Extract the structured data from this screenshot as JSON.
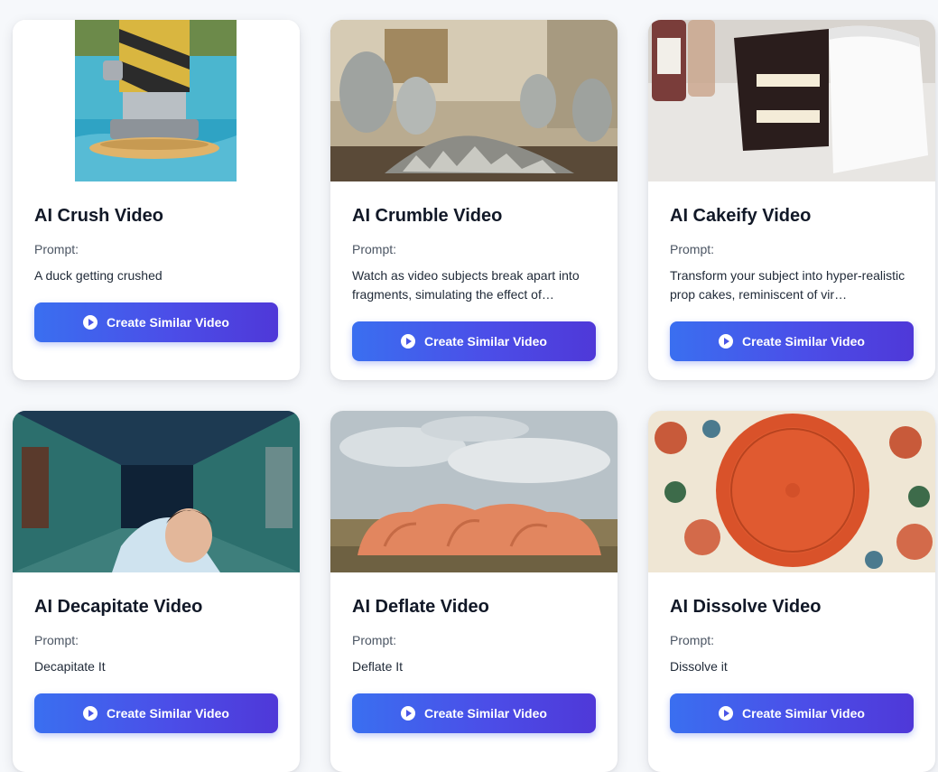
{
  "cards": [
    {
      "title": "AI Crush Video",
      "prompt_label": "Prompt:",
      "prompt": "A duck getting crushed",
      "button": "Create Similar Video"
    },
    {
      "title": "AI Crumble Video",
      "prompt_label": "Prompt:",
      "prompt": "Watch as video subjects break apart into fragments, simulating the effect of…",
      "button": "Create Similar Video"
    },
    {
      "title": "AI Cakeify Video",
      "prompt_label": "Prompt:",
      "prompt": "Transform your subject into hyper-realistic prop cakes, reminiscent of vir…",
      "button": "Create Similar Video"
    },
    {
      "title": "AI Decapitate Video",
      "prompt_label": "Prompt:",
      "prompt": "Decapitate It",
      "button": "Create Similar Video"
    },
    {
      "title": "AI Deflate Video",
      "prompt_label": "Prompt:",
      "prompt": "Deflate It",
      "button": "Create Similar Video"
    },
    {
      "title": "AI Dissolve Video",
      "prompt_label": "Prompt:",
      "prompt": "Dissolve it",
      "button": "Create Similar Video"
    }
  ],
  "colors": {
    "button_gradient_start": "#3a6ff0",
    "button_gradient_end": "#4f38d8",
    "title": "#111827",
    "page_background": "#f6f8fb"
  },
  "icons": {
    "button_icon": "play-circle-icon"
  }
}
